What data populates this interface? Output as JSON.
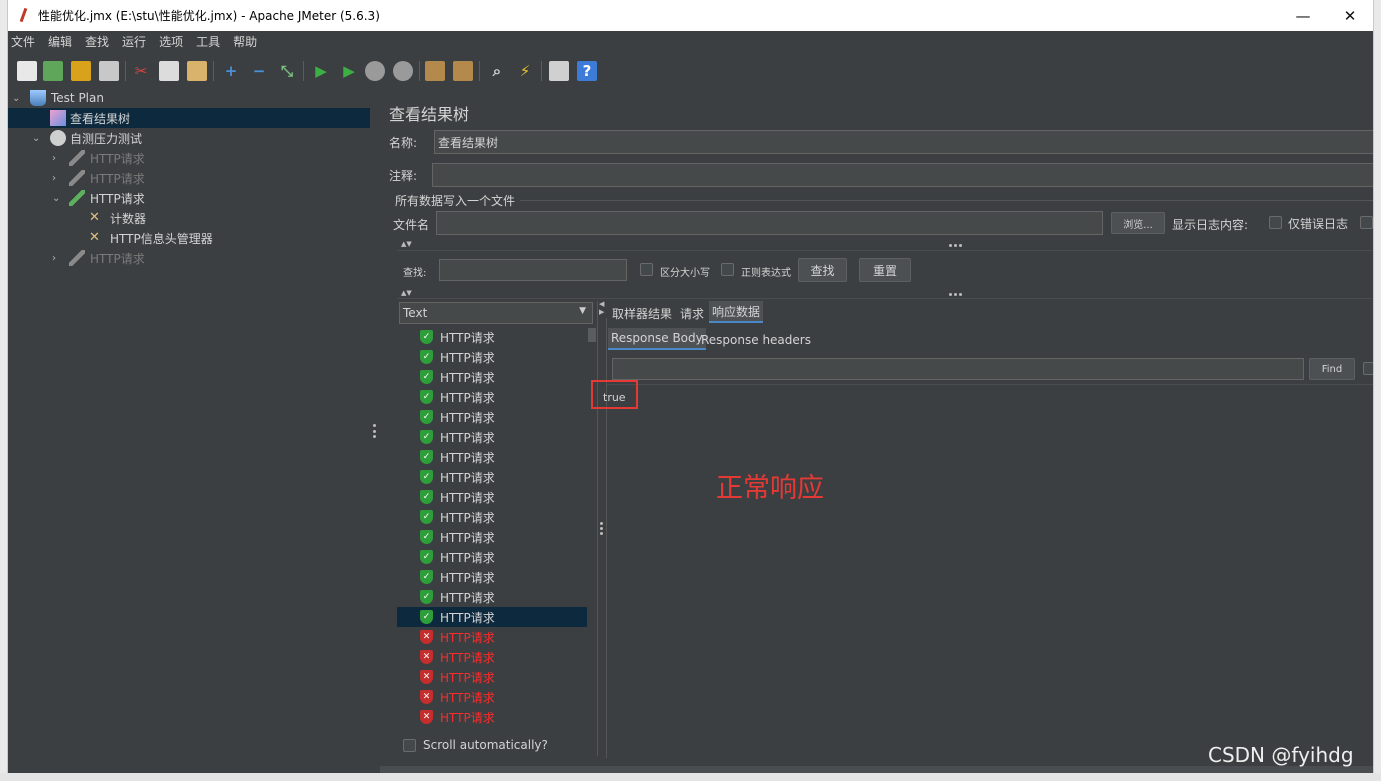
{
  "window": {
    "title": "性能优化.jmx (E:\\stu\\性能优化.jmx) - Apache JMeter (5.6.3)",
    "minimize": "—",
    "maximize": "☐",
    "close": "✕"
  },
  "menu": [
    "文件",
    "编辑",
    "查找",
    "运行",
    "选项",
    "工具",
    "帮助"
  ],
  "tree": {
    "items": [
      {
        "label": "Test Plan",
        "icon": "flask-icon",
        "arrow": "⌄"
      },
      {
        "label": "查看结果树",
        "icon": "chart-icon",
        "arrow": ""
      },
      {
        "label": "自测压力测试",
        "icon": "gear-icon",
        "arrow": "⌄"
      },
      {
        "label": "HTTP请求",
        "icon": "pipette-icon",
        "arrow": "›"
      },
      {
        "label": "HTTP请求",
        "icon": "pipette-icon",
        "arrow": "›"
      },
      {
        "label": "HTTP请求",
        "icon": "pipette-icon",
        "arrow": "⌄"
      },
      {
        "label": "计数器",
        "icon": "tools-icon",
        "arrow": ""
      },
      {
        "label": "HTTP信息头管理器",
        "icon": "tools-icon",
        "arrow": ""
      },
      {
        "label": "HTTP请求",
        "icon": "pipette-icon",
        "arrow": "›"
      }
    ]
  },
  "panel": {
    "title": "查看结果树",
    "name_label": "名称:",
    "name_value": "查看结果树",
    "comment_label": "注释:",
    "comment_value": "",
    "file_section": "所有数据写入一个文件",
    "filename_label": "文件名",
    "filename_value": "",
    "browse_button": "浏览...",
    "log_display_label": "显示日志内容:",
    "errors_only_label": "仅错误日志",
    "search_label": "查找:",
    "search_value": "",
    "case_label": "区分大小写",
    "regex_label": "正则表达式",
    "find_button": "查找",
    "reset_button": "重置"
  },
  "results": {
    "renderer": "Text",
    "items": [
      {
        "label": "HTTP请求",
        "status": "success"
      },
      {
        "label": "HTTP请求",
        "status": "success"
      },
      {
        "label": "HTTP请求",
        "status": "success"
      },
      {
        "label": "HTTP请求",
        "status": "success"
      },
      {
        "label": "HTTP请求",
        "status": "success"
      },
      {
        "label": "HTTP请求",
        "status": "success"
      },
      {
        "label": "HTTP请求",
        "status": "success"
      },
      {
        "label": "HTTP请求",
        "status": "success"
      },
      {
        "label": "HTTP请求",
        "status": "success"
      },
      {
        "label": "HTTP请求",
        "status": "success"
      },
      {
        "label": "HTTP请求",
        "status": "success"
      },
      {
        "label": "HTTP请求",
        "status": "success"
      },
      {
        "label": "HTTP请求",
        "status": "success"
      },
      {
        "label": "HTTP请求",
        "status": "success"
      },
      {
        "label": "HTTP请求",
        "status": "success",
        "selected": true
      },
      {
        "label": "HTTP请求",
        "status": "error"
      },
      {
        "label": "HTTP请求",
        "status": "error"
      },
      {
        "label": "HTTP请求",
        "status": "error"
      },
      {
        "label": "HTTP请求",
        "status": "error"
      },
      {
        "label": "HTTP请求",
        "status": "error"
      }
    ],
    "scroll_auto_label": "Scroll automatically?"
  },
  "detail": {
    "tabs": [
      "取样器结果",
      "请求",
      "响应数据"
    ],
    "active_tab": "响应数据",
    "subtabs": [
      "Response Body",
      "Response headers"
    ],
    "find_value": "",
    "find_button": "Find",
    "response_body": "true",
    "annotation": "正常响应"
  },
  "watermark": "CSDN @fyihdg",
  "colors": {
    "background": "#3c3f41",
    "selection": "#0d293e",
    "success": "#2e9e3a",
    "error": "#ff2a2a",
    "annotation": "#e53935"
  }
}
